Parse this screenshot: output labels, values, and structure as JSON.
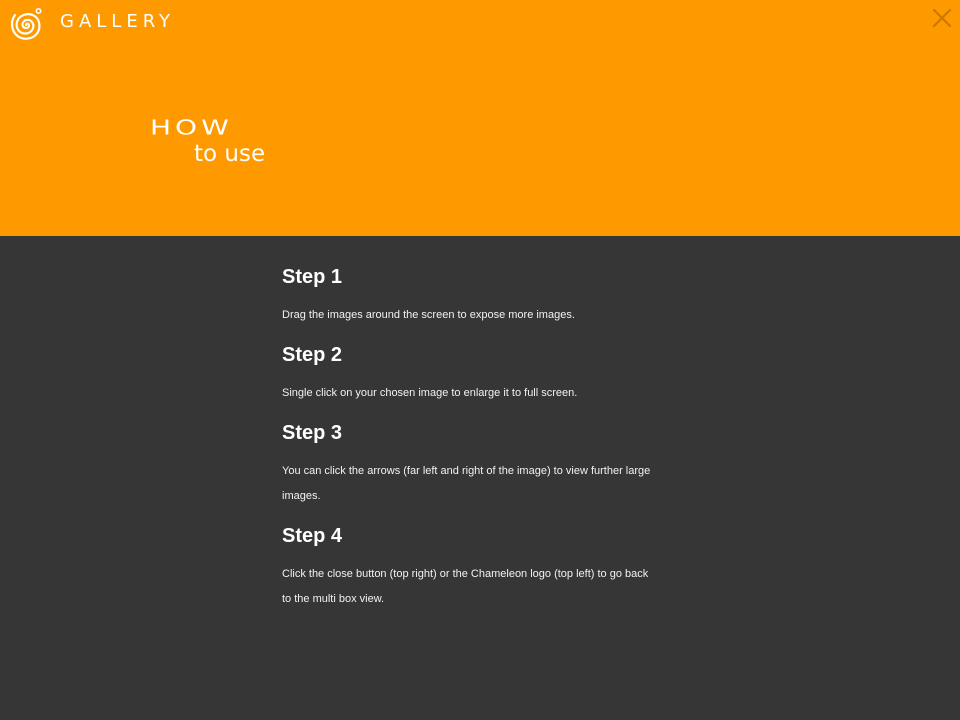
{
  "header": {
    "brand_text": "GALLERY",
    "close_label": "×",
    "title_main": "HOW",
    "title_sub": "to use"
  },
  "steps": [
    {
      "title": "Step 1",
      "text": "Drag the images around the screen to expose more images."
    },
    {
      "title": "Step 2",
      "text": "Single click on your chosen image to enlarge it to full screen."
    },
    {
      "title": "Step 3",
      "text": "You can click the arrows (far left and right of the image) to view further large images."
    },
    {
      "title": "Step 4",
      "text": "Click the close button (top right) or the Chameleon logo (top left) to go back to the multi box view."
    }
  ],
  "colors": {
    "header_bg": "#ff9900",
    "body_bg": "#363636",
    "text": "#ffffff",
    "close_icon": "#c97800"
  },
  "icons": {
    "logo": "spiral-logo-icon",
    "close": "close-icon"
  }
}
